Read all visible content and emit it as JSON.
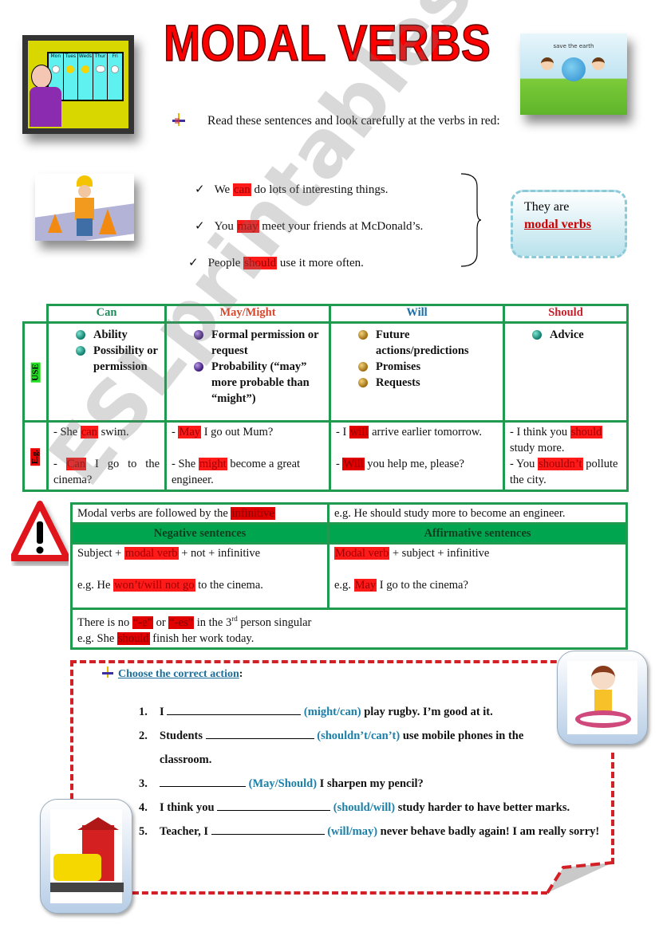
{
  "title": "MODAL VERBS",
  "colors": {
    "title_red": "#ff0000",
    "highlight": "#ff1a1a",
    "table_green": "#1f9a4f",
    "header_green": "#00a64f",
    "option_blue": "#1b7fa8",
    "dashed_red": "#d31f26"
  },
  "images": {
    "weather_board": "Weatherman cartoon with weekly forecast board",
    "weather_days": [
      "Mon",
      "Tues",
      "Weds",
      "Thur",
      "Fri"
    ],
    "earth_caption": "save the earth",
    "worker": "Road worker with traffic cones",
    "warning": "warning-triangle",
    "girl": "Girl with swim ring",
    "school": "School with school bus"
  },
  "intro": {
    "icon": "pin-bullet-icon",
    "text": "Read these sentences and look carefully at the verbs in red:"
  },
  "examples": [
    {
      "before": "We",
      "modal": "can",
      "after": "do lots of interesting things."
    },
    {
      "before": "You",
      "modal": "may",
      "after": "meet your friends at McDonald’s."
    },
    {
      "before": "People",
      "modal": "should",
      "after": "use it more often."
    }
  ],
  "callout": {
    "line1": "They are",
    "line2": "modal verbs"
  },
  "uses_table": {
    "row_labels": {
      "use": "USE",
      "eg": "E.g."
    },
    "columns": [
      {
        "header": "Can",
        "header_color": "#1e8a5a",
        "uses": [
          "Ability",
          "Possibility or permission"
        ],
        "bullet": "teal",
        "examples": [
          {
            "before": "- She",
            "modal": "can",
            "after": "swim."
          },
          {
            "before": "-",
            "modal": "Can",
            "after": "I go to the cinema?"
          }
        ]
      },
      {
        "header": "May/Might",
        "header_color": "#d9472b",
        "uses": [
          "Formal permission or request",
          "Probability (“may” more probable than “might”)"
        ],
        "bullet": "purple",
        "examples": [
          {
            "before": "-",
            "modal": "May",
            "after": "I go out Mum?"
          },
          {
            "before": "- She",
            "modal": "might",
            "after": "become a great engineer."
          }
        ]
      },
      {
        "header": "Will",
        "header_color": "#1b6fa8",
        "uses": [
          "Future actions/predictions",
          "Promises",
          "Requests"
        ],
        "bullet": "gold",
        "examples": [
          {
            "before": "- I",
            "modal": "will",
            "after": "arrive earlier tomorrow."
          },
          {
            "before": "-",
            "modal": "Will",
            "after": "you help me, please?"
          }
        ]
      },
      {
        "header": "Should",
        "header_color": "#c4202a",
        "uses": [
          "Advice"
        ],
        "bullet": "teal",
        "examples": [
          {
            "before": "- I think you",
            "modal": "should",
            "after": "study more."
          },
          {
            "before": "- You",
            "modal": "shouldn’t",
            "after": "pollute the city."
          }
        ]
      }
    ]
  },
  "grammar": {
    "rule_before": "Modal verbs are followed by the",
    "rule_highlight": "infinitive",
    "rule_example": "e.g. He should study more to become an engineer.",
    "negative_header": "Negative sentences",
    "affirmative_header": "Affirmative sentences",
    "negative_formula_before": "Subject +",
    "negative_formula_modal": "modal verb",
    "negative_formula_after": "+ not + infinitive",
    "negative_example_before": "e.g. He",
    "negative_example_modal": "won’t/will not go",
    "negative_example_after": "to the cinema.",
    "affirmative_formula_modal": "Modal verb",
    "affirmative_formula_after": "+ subject + infinitive",
    "affirmative_example_before": "e.g.",
    "affirmative_example_modal": "May",
    "affirmative_example_after": "I go to the cinema?",
    "third_person_a": "There is no",
    "third_person_e": "“-e”",
    "third_person_or": "or",
    "third_person_es": "“-es”",
    "third_person_b": "in the 3",
    "third_person_sup": "rd",
    "third_person_c": "person singular",
    "third_example_before": "e.g. She",
    "third_example_modal": "should",
    "third_example_after": "finish her work today."
  },
  "exercise": {
    "heading": "Choose the correct action",
    "heading_suffix": ":",
    "items": [
      {
        "num": "1.",
        "before": "I",
        "options": "(might/can)",
        "after": "play rugby. I’m good at it."
      },
      {
        "num": "2.",
        "before": "Students",
        "options": "(shouldn’t/can’t)",
        "after": "use mobile phones in the classroom."
      },
      {
        "num": "3.",
        "before": "",
        "options": "(May/Should)",
        "after": "I sharpen my pencil?"
      },
      {
        "num": "4.",
        "before": "I think you",
        "options": "(should/will)",
        "after": "study harder to have better marks."
      },
      {
        "num": "5.",
        "before": "Teacher, I",
        "options": "(will/may)",
        "after": "never behave badly again! I am really sorry!"
      }
    ]
  },
  "watermark": "ESLprintables.com"
}
